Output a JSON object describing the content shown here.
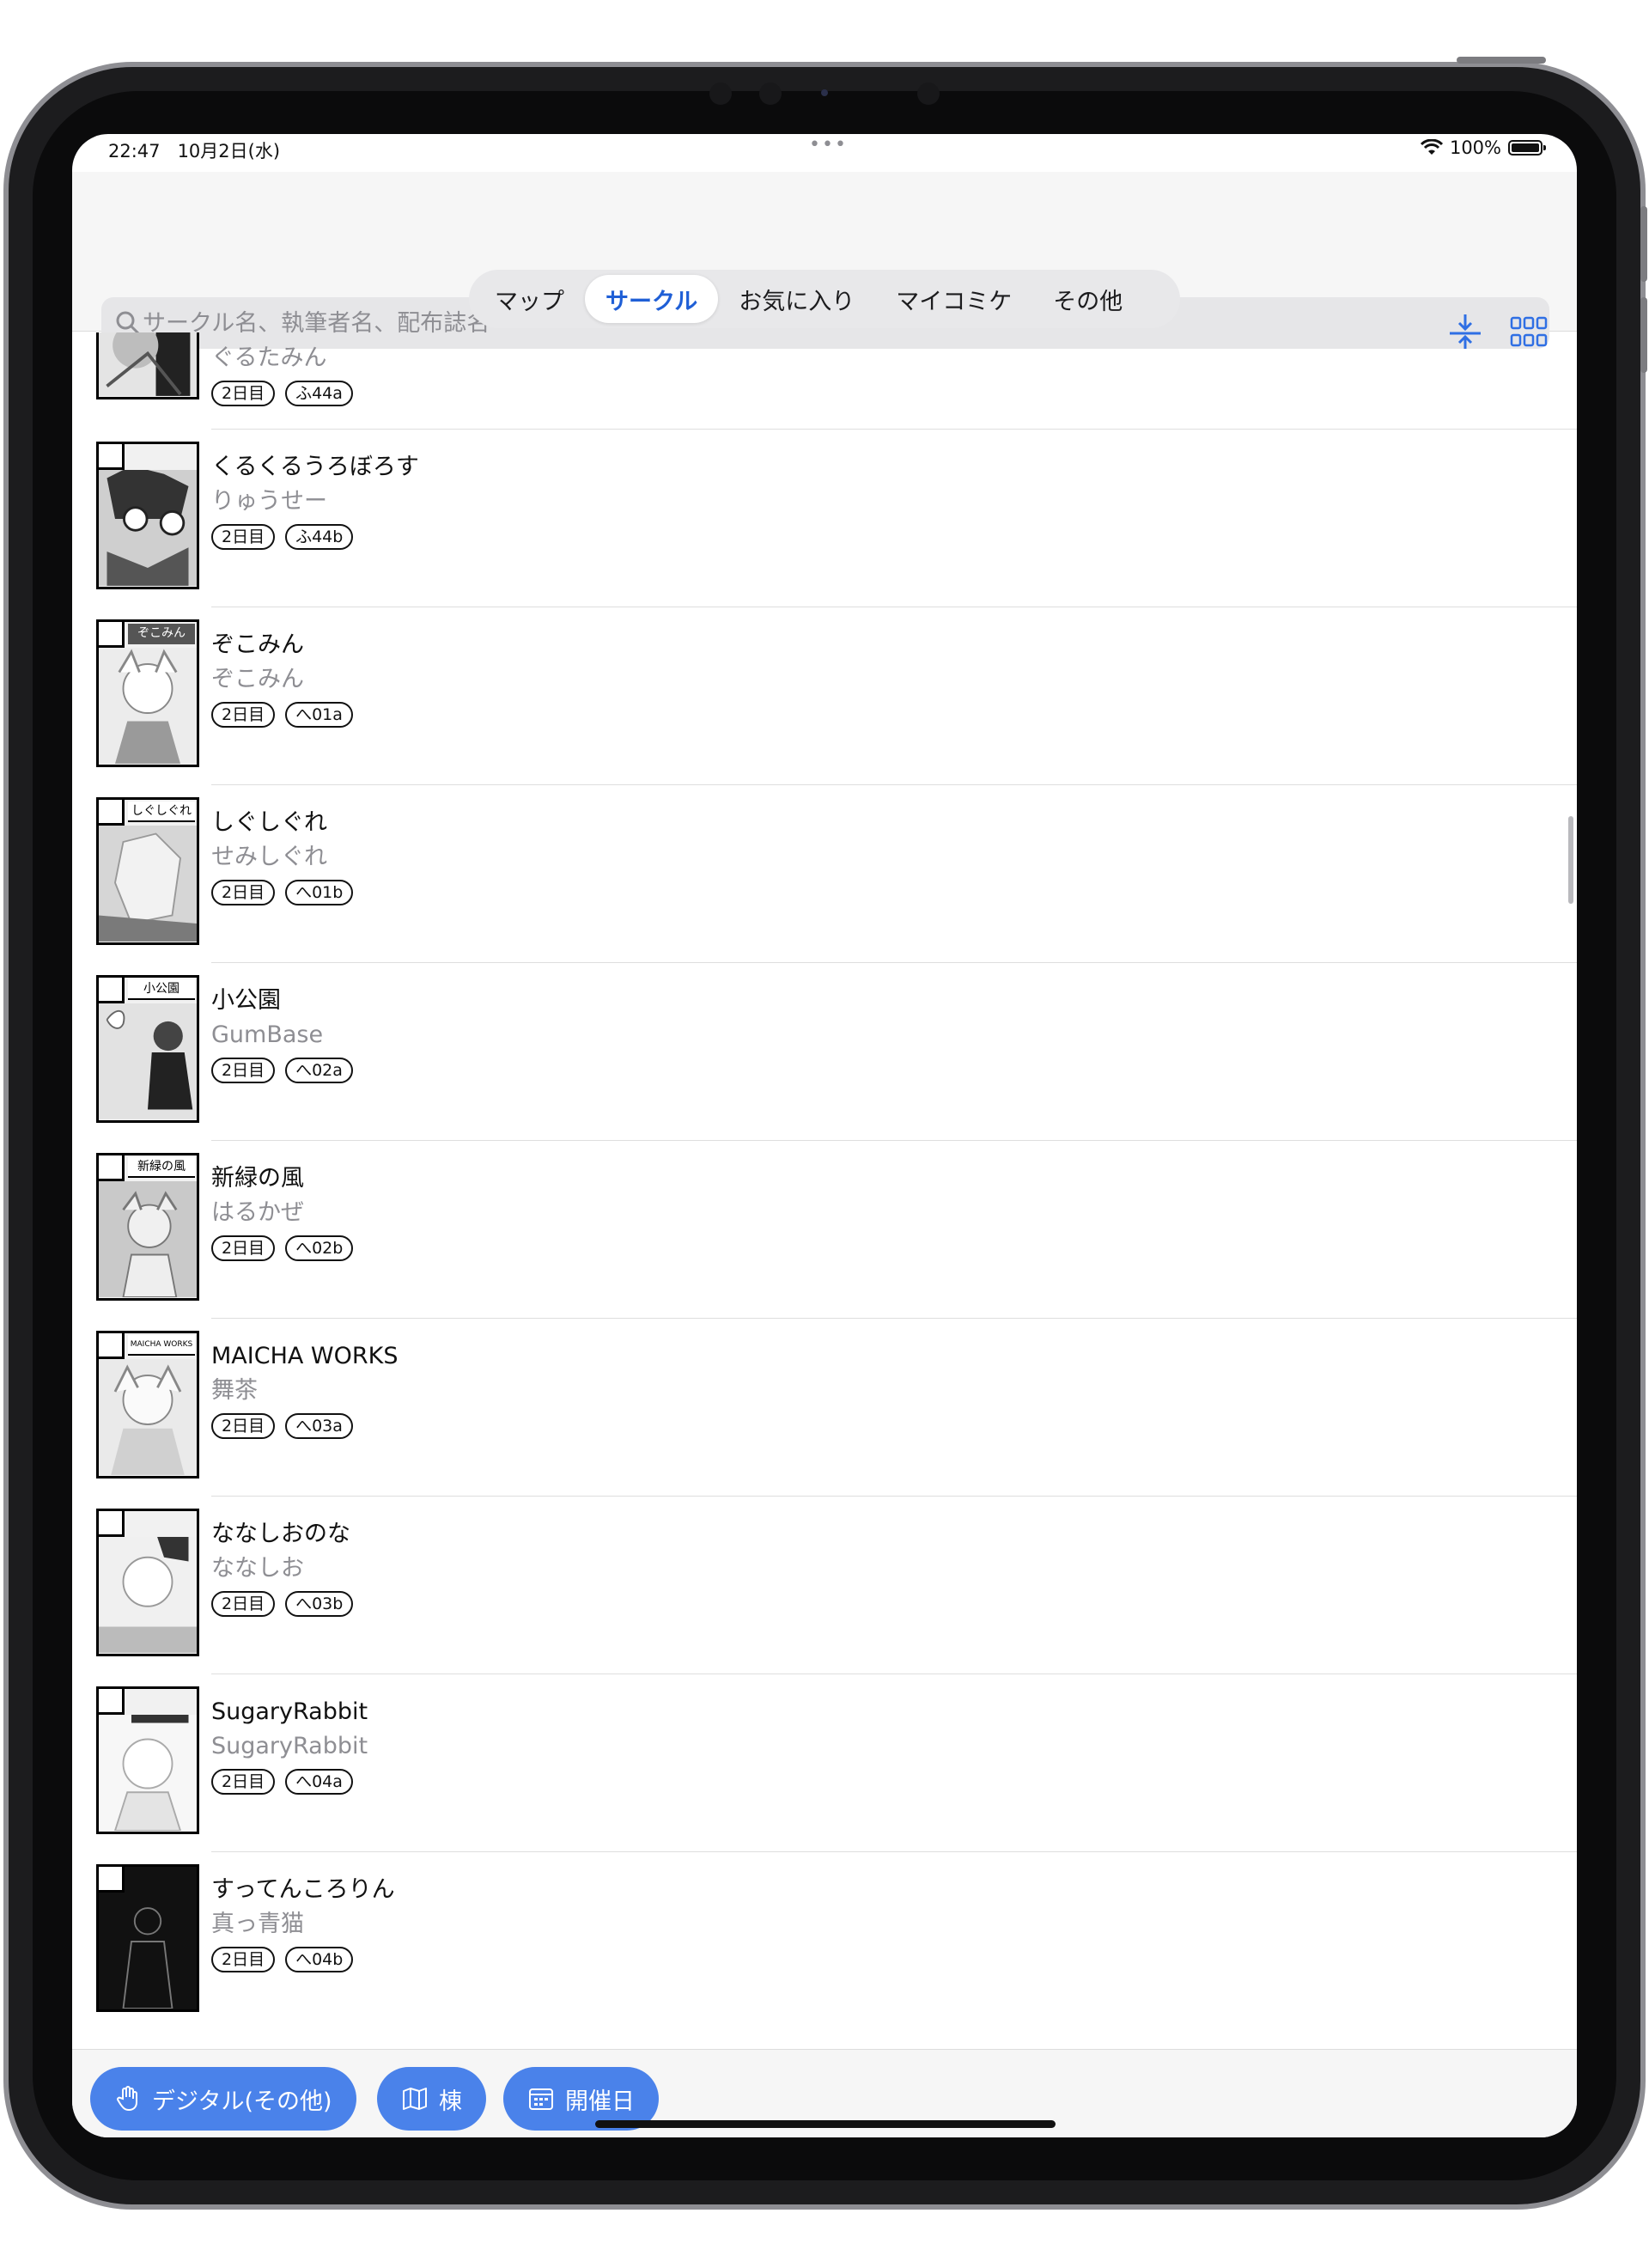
{
  "status_bar": {
    "time": "22:47",
    "date": "10月2日(水)",
    "more": "•••",
    "battery": "100%"
  },
  "header": {
    "tabs": [
      {
        "label": "マップ",
        "active": false
      },
      {
        "label": "サークル",
        "active": true
      },
      {
        "label": "お気に入り",
        "active": false
      },
      {
        "label": "マイコミケ",
        "active": false
      },
      {
        "label": "その他",
        "active": false
      }
    ],
    "tools": [
      "download-icon",
      "grid-view-icon"
    ],
    "search_placeholder": "サークル名、執筆者名、配布誌名"
  },
  "list": [
    {
      "name": "",
      "author": "ぐるたみん",
      "day": "2日目",
      "space": "ふ44a",
      "thumb_label": ""
    },
    {
      "name": "くるくるうろぼろす",
      "author": "りゅうせー",
      "day": "2日目",
      "space": "ふ44b",
      "thumb_label": ""
    },
    {
      "name": "ぞこみん",
      "author": "ぞこみん",
      "day": "2日目",
      "space": "へ01a",
      "thumb_label": "ぞこみん"
    },
    {
      "name": "しぐしぐれ",
      "author": "せみしぐれ",
      "day": "2日目",
      "space": "へ01b",
      "thumb_label": "しぐしぐれ"
    },
    {
      "name": "小公園",
      "author": "GumBase",
      "day": "2日目",
      "space": "へ02a",
      "thumb_label": "小公園"
    },
    {
      "name": "新緑の風",
      "author": "はるかぜ",
      "day": "2日目",
      "space": "へ02b",
      "thumb_label": "新緑の風"
    },
    {
      "name": "MAICHA WORKS",
      "author": "舞茶",
      "day": "2日目",
      "space": "へ03a",
      "thumb_label": "MAICHA WORKS"
    },
    {
      "name": "ななしおのな",
      "author": "ななしお",
      "day": "2日目",
      "space": "へ03b",
      "thumb_label": ""
    },
    {
      "name": "SugaryRabbit",
      "author": "SugaryRabbit",
      "day": "2日目",
      "space": "へ04a",
      "thumb_label": ""
    },
    {
      "name": "すってんころりん",
      "author": "真っ青猫",
      "day": "2日目",
      "space": "へ04b",
      "thumb_label": ""
    }
  ],
  "filters": [
    {
      "label": "デジタル(その他)",
      "icon": "hand-pointer-icon"
    },
    {
      "label": "棟",
      "icon": "map-icon"
    },
    {
      "label": "開催日",
      "icon": "calendar-icon"
    }
  ],
  "colors": {
    "accent": "#4a82ea",
    "active_tab": "#1f5fd6"
  }
}
